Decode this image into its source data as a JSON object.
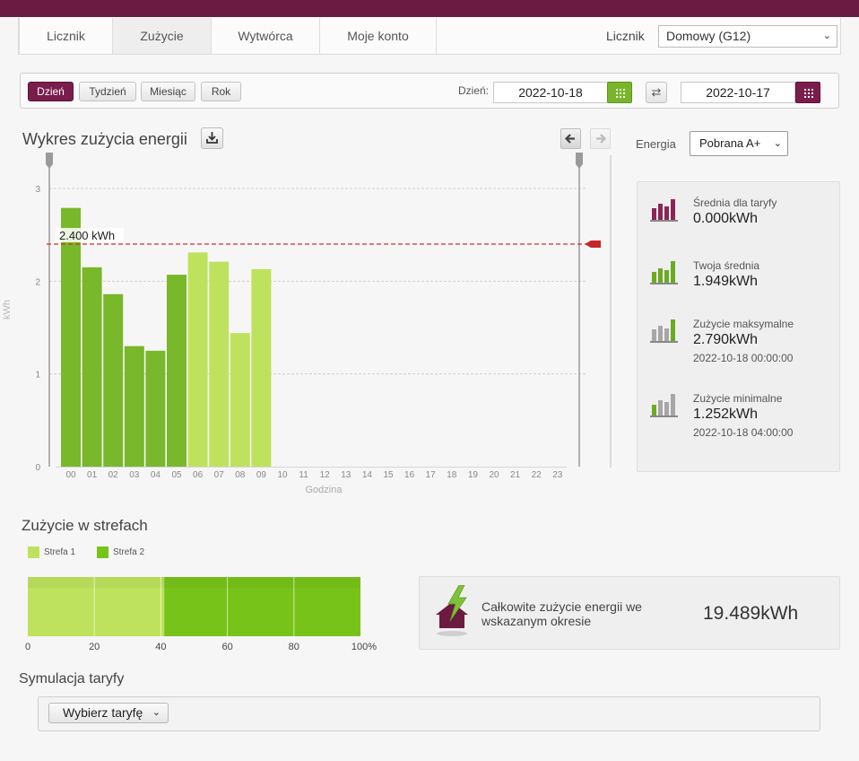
{
  "nav": {
    "tabs": [
      {
        "label": "Licznik",
        "active": false
      },
      {
        "label": "Zużycie",
        "active": true
      },
      {
        "label": "Wytwórca",
        "active": false
      },
      {
        "label": "Moje konto",
        "active": false
      }
    ],
    "meter_label": "Licznik",
    "meter_value": "Domowy (G12)"
  },
  "toolbar": {
    "periods": [
      {
        "label": "Dzień",
        "active": true
      },
      {
        "label": "Tydzień",
        "active": false
      },
      {
        "label": "Miesiąc",
        "active": false
      },
      {
        "label": "Rok",
        "active": false
      }
    ],
    "day_label": "Dzień:",
    "date_from": "2022-10-18",
    "date_to": "2022-10-17"
  },
  "chart_section": {
    "title": "Wykres zużycia energii"
  },
  "energy": {
    "label": "Energia",
    "value": "Pobrana A+"
  },
  "chart_data": {
    "type": "bar",
    "ylabel": "kWh",
    "xlabel": "Godzina",
    "ylim": [
      0,
      3
    ],
    "yticks": [
      "0",
      "1",
      "2",
      "3"
    ],
    "categories": [
      "00",
      "01",
      "02",
      "03",
      "04",
      "05",
      "06",
      "07",
      "08",
      "09",
      "10",
      "11",
      "12",
      "13",
      "14",
      "15",
      "16",
      "17",
      "18",
      "19",
      "20",
      "21",
      "22",
      "23"
    ],
    "values": [
      2.79,
      2.15,
      1.86,
      1.3,
      1.25,
      2.07,
      2.31,
      2.21,
      1.44,
      2.13,
      null,
      null,
      null,
      null,
      null,
      null,
      null,
      null,
      null,
      null,
      null,
      null,
      null,
      null
    ],
    "zone": [
      2,
      2,
      2,
      2,
      2,
      2,
      1,
      1,
      1,
      1,
      null,
      null,
      null,
      null,
      null,
      null,
      null,
      null,
      null,
      null,
      null,
      null,
      null,
      null
    ],
    "threshold": {
      "value": 2.4,
      "label": "2.400 kWh"
    },
    "grid": true,
    "colors": {
      "strefa_1": "#bfe25e",
      "strefa_2": "#79b72b",
      "threshold": "#d32f2f"
    }
  },
  "stats": [
    {
      "icon": "bar-chart-maroon-icon",
      "label": "Średnia dla taryfy",
      "value": "0.000kWh",
      "date": ""
    },
    {
      "icon": "bar-chart-green-icon",
      "label": "Twoja średnia",
      "value": "1.949kWh",
      "date": ""
    },
    {
      "icon": "bar-chart-max-icon",
      "label": "Zużycie maksymalne",
      "value": "2.790kWh",
      "date": "2022-10-18 00:00:00"
    },
    {
      "icon": "bar-chart-min-icon",
      "label": "Zużycie minimalne",
      "value": "1.252kWh",
      "date": "2022-10-18 04:00:00"
    }
  ],
  "zones": {
    "title": "Zużycie w strefach",
    "legend": [
      {
        "label": "Strefa 1",
        "color": "#bfe25e"
      },
      {
        "label": "Strefa 2",
        "color": "#78c31a"
      }
    ],
    "shares_percent": [
      41,
      59
    ],
    "axis_ticks": [
      "0",
      "20",
      "40",
      "60",
      "80",
      "100%"
    ]
  },
  "total": {
    "text": "Całkowite zużycie energii we wskazanym okresie",
    "value": "19.489kWh"
  },
  "simulation": {
    "title": "Symulacja taryfy",
    "button_label": "Wybierz taryfę"
  }
}
